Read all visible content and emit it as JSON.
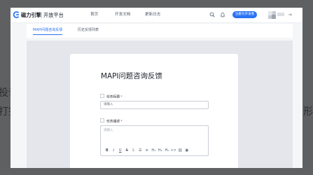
{
  "background": {
    "left_text_1": "投诉",
    "left_text_2": "打完",
    "right_text": "形"
  },
  "topnav": {
    "brand_name": "磁力引擎",
    "brand_sub": "开放平台",
    "links": [
      "首页",
      "开发文档",
      "更新日志"
    ],
    "cta_label": "注册为开发者",
    "logout_glyph": "⇥",
    "icons": [
      "logo-icon",
      "search-icon",
      "bell-icon",
      "logout-icon"
    ]
  },
  "tabs": [
    {
      "label": "MAPI问题咨询反馈",
      "active": true
    },
    {
      "label": "历史反馈列表",
      "active": false
    }
  ],
  "form": {
    "title": "MAPI问题咨询反馈",
    "title_field": {
      "label": "任务标题",
      "required": "*",
      "placeholder": "请输入"
    },
    "desc_field": {
      "label": "任务描述",
      "required": "*",
      "placeholder": "请输入"
    },
    "toolbar": {
      "bold": "B",
      "italic": "I",
      "underline": "U",
      "strike": "S",
      "ordered_list": "⒈",
      "bullet_list": "☰",
      "align": "≡",
      "h1": "H₁",
      "h2": "H₂",
      "h3": "H₃",
      "code": "<>",
      "link": "⛓",
      "image": "▣"
    }
  },
  "colors": {
    "accent": "#2a73f5",
    "required": "#f53f3f",
    "overlay": "#5f6062"
  }
}
